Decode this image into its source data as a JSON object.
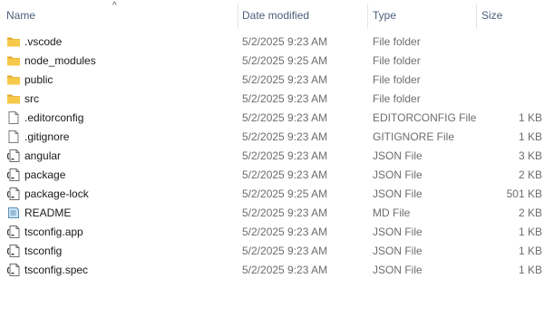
{
  "columns": {
    "name": "Name",
    "date": "Date modified",
    "type": "Type",
    "size": "Size"
  },
  "rows": [
    {
      "name": ".vscode",
      "date": "5/2/2025 9:23 AM",
      "type": "File folder",
      "size": "",
      "icon": "folder-icon"
    },
    {
      "name": "node_modules",
      "date": "5/2/2025 9:25 AM",
      "type": "File folder",
      "size": "",
      "icon": "folder-icon"
    },
    {
      "name": "public",
      "date": "5/2/2025 9:23 AM",
      "type": "File folder",
      "size": "",
      "icon": "folder-icon"
    },
    {
      "name": "src",
      "date": "5/2/2025 9:23 AM",
      "type": "File folder",
      "size": "",
      "icon": "folder-icon"
    },
    {
      "name": ".editorconfig",
      "date": "5/2/2025 9:23 AM",
      "type": "EDITORCONFIG File",
      "size": "1 KB",
      "icon": "file-icon"
    },
    {
      "name": ".gitignore",
      "date": "5/2/2025 9:23 AM",
      "type": "GITIGNORE File",
      "size": "1 KB",
      "icon": "file-icon"
    },
    {
      "name": "angular",
      "date": "5/2/2025 9:23 AM",
      "type": "JSON File",
      "size": "3 KB",
      "icon": "json-file-icon"
    },
    {
      "name": "package",
      "date": "5/2/2025 9:23 AM",
      "type": "JSON File",
      "size": "2 KB",
      "icon": "json-file-icon"
    },
    {
      "name": "package-lock",
      "date": "5/2/2025 9:25 AM",
      "type": "JSON File",
      "size": "501 KB",
      "icon": "json-file-icon"
    },
    {
      "name": "README",
      "date": "5/2/2025 9:23 AM",
      "type": "MD File",
      "size": "2 KB",
      "icon": "markdown-file-icon"
    },
    {
      "name": "tsconfig.app",
      "date": "5/2/2025 9:23 AM",
      "type": "JSON File",
      "size": "1 KB",
      "icon": "json-file-icon"
    },
    {
      "name": "tsconfig",
      "date": "5/2/2025 9:23 AM",
      "type": "JSON File",
      "size": "1 KB",
      "icon": "json-file-icon"
    },
    {
      "name": "tsconfig.spec",
      "date": "5/2/2025 9:23 AM",
      "type": "JSON File",
      "size": "1 KB",
      "icon": "json-file-icon"
    }
  ],
  "colors": {
    "header_text": "#4c607a",
    "folder": "#f7c94b",
    "folder_dark": "#e0a82e",
    "secondary_text": "#6d6d6d"
  }
}
